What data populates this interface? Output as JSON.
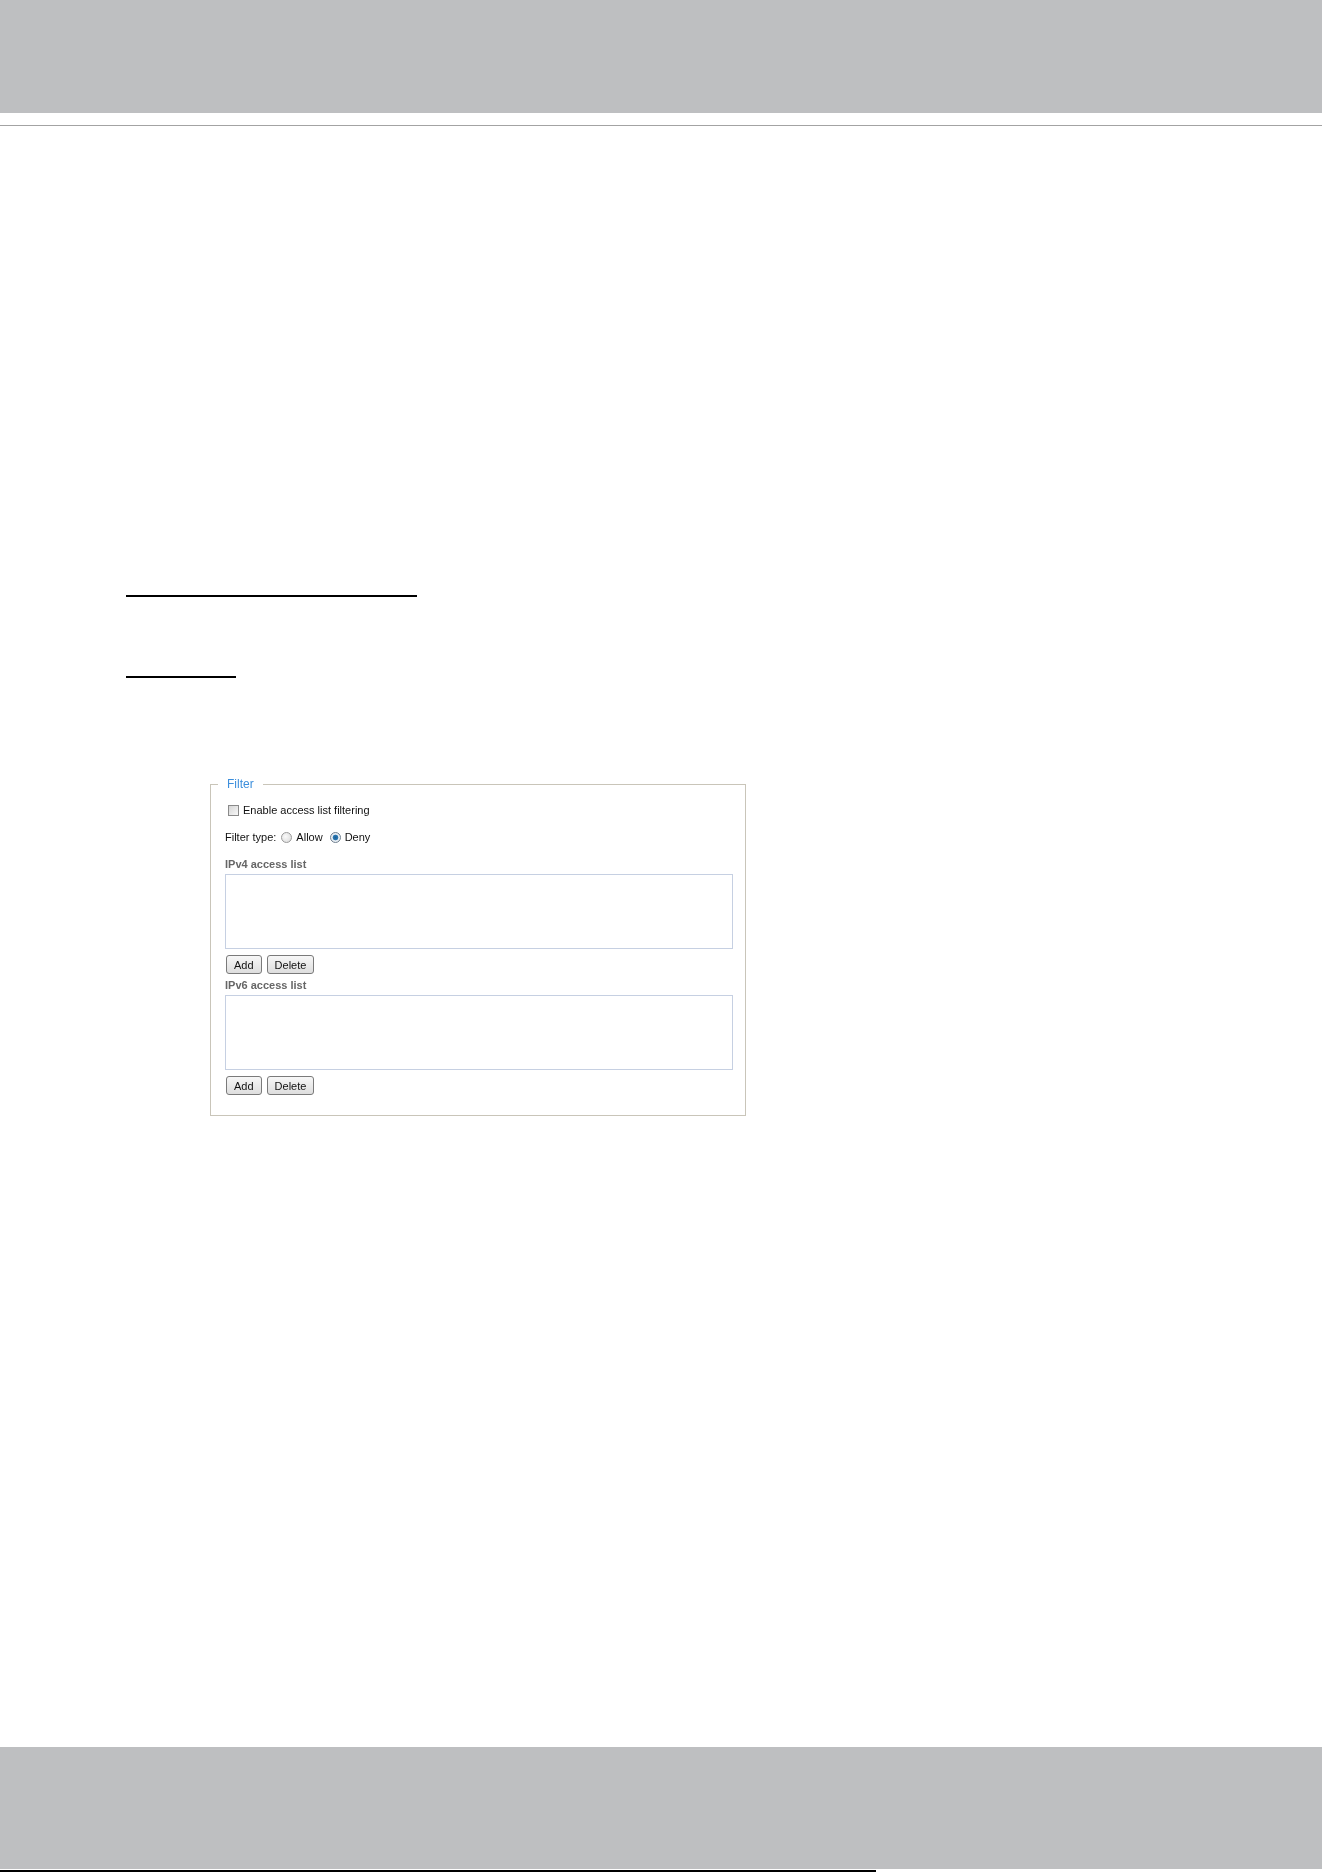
{
  "filter": {
    "legend": "Filter",
    "enable": {
      "label": "Enable access list filtering",
      "checked": false
    },
    "filter_type": {
      "label": "Filter type:",
      "options": [
        {
          "label": "Allow",
          "selected": false
        },
        {
          "label": "Deny",
          "selected": true
        }
      ]
    },
    "lists": [
      {
        "label": "IPv4 access list",
        "buttons": [
          "Add",
          "Delete"
        ]
      },
      {
        "label": "IPv6 access list",
        "buttons": [
          "Add",
          "Delete"
        ]
      }
    ]
  }
}
